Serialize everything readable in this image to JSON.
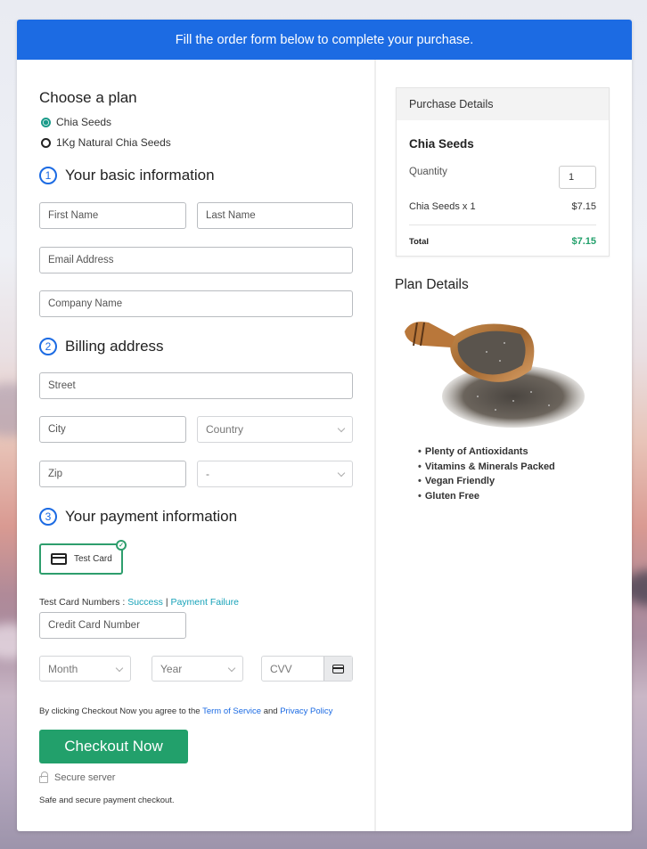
{
  "banner": {
    "text": "Fill the order form below to complete your purchase."
  },
  "plan": {
    "title": "Choose a plan",
    "options": [
      {
        "label": "Chia Seeds",
        "selected": true
      },
      {
        "label": "1Kg Natural Chia Seeds",
        "selected": false
      }
    ]
  },
  "sections": [
    {
      "number": "1",
      "title": "Your basic information"
    },
    {
      "number": "2",
      "title": "Billing address"
    },
    {
      "number": "3",
      "title": "Your payment information"
    }
  ],
  "basic_info": {
    "first_name": {
      "placeholder": "First Name",
      "value": ""
    },
    "last_name": {
      "placeholder": "Last Name",
      "value": ""
    },
    "email": {
      "placeholder": "Email Address",
      "value": ""
    },
    "company": {
      "placeholder": "Company Name",
      "value": ""
    }
  },
  "billing": {
    "street": {
      "placeholder": "Street",
      "value": ""
    },
    "city": {
      "placeholder": "City",
      "value": ""
    },
    "country": {
      "selected": "Country"
    },
    "zip": {
      "placeholder": "Zip",
      "value": ""
    },
    "state": {
      "selected": "-"
    }
  },
  "payment": {
    "method_label": "Test Card",
    "test_numbers_label": "Test Card Numbers :",
    "success_link": "Success",
    "separator": "|",
    "failure_link": "Payment Failure",
    "card_number": {
      "placeholder": "Credit Card Number",
      "value": ""
    },
    "month": {
      "selected": "Month"
    },
    "year": {
      "selected": "Year"
    },
    "cvv": {
      "placeholder": "CVV",
      "value": ""
    }
  },
  "agreement": {
    "prefix": "By clicking Checkout Now you agree to the",
    "terms_link": "Term of Service",
    "and": "and",
    "privacy_link": "Privacy Policy"
  },
  "checkout_button": "Checkout Now",
  "secure_label": "Secure server",
  "safe_text": "Safe and secure payment checkout.",
  "purchase_details": {
    "title": "Purchase Details",
    "product_name": "Chia Seeds",
    "quantity_label": "Quantity",
    "quantity": "1",
    "line_item": "Chia Seeds x 1",
    "line_price": "$7.15",
    "total_label": "Total",
    "total_value": "$7.15"
  },
  "plan_details": {
    "title": "Plan Details",
    "features": [
      "Plenty of Antioxidants",
      "Vitamins & Minerals Packed",
      "Vegan Friendly",
      "Gluten Free"
    ]
  },
  "colors": {
    "banner": "#1c6be3",
    "accent_green": "#22a06b",
    "link_teal": "#17a2b8"
  }
}
